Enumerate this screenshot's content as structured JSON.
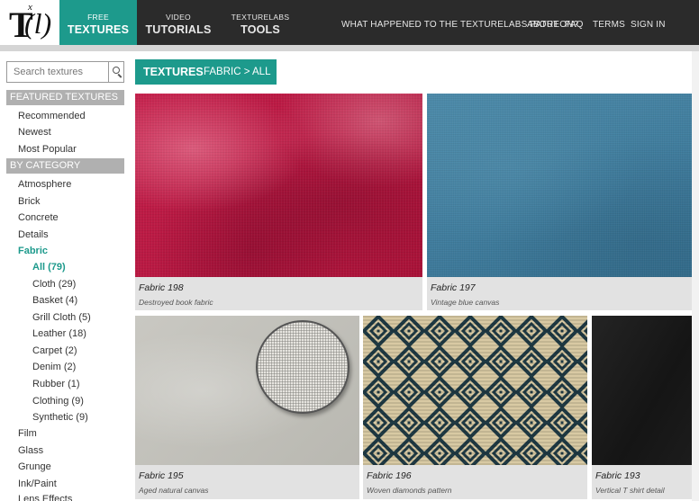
{
  "logo": {
    "letter": "T",
    "superscript": "x",
    "paren": "(l)"
  },
  "topnav": {
    "tabs": [
      {
        "small": "FREE",
        "big": "TEXTURES"
      },
      {
        "small": "VIDEO",
        "big": "TUTORIALS"
      },
      {
        "small": "TEXTURELABS",
        "big": "TOOLS"
      }
    ],
    "links": [
      "WHAT HAPPENED TO THE TEXTURELABS PATREON?",
      "ABOUT",
      "FAQ",
      "TERMS",
      "SIGN IN"
    ]
  },
  "search": {
    "placeholder": "Search textures"
  },
  "sidebar": {
    "featured_heading": "FEATURED TEXTURES",
    "featured": [
      "Recommended",
      "Newest",
      "Most Popular"
    ],
    "category_heading": "BY CATEGORY",
    "categories_top": [
      "Atmosphere",
      "Brick",
      "Concrete",
      "Details"
    ],
    "active_category": "Fabric",
    "subcategories": [
      "All (79)",
      "Cloth (29)",
      "Basket (4)",
      "Grill Cloth (5)",
      "Leather (18)",
      "Carpet (2)",
      "Denim (2)",
      "Rubber (1)",
      "Clothing (9)",
      "Synthetic (9)"
    ],
    "categories_bottom": [
      "Film",
      "Glass",
      "Grunge",
      "Ink/Paint",
      "Lens Effects"
    ]
  },
  "breadcrumb": {
    "section": "TEXTURES",
    "path": "FABRIC > ALL"
  },
  "cards": [
    {
      "title": "Fabric 198",
      "subtitle": "Destroyed book fabric"
    },
    {
      "title": "Fabric 197",
      "subtitle": "Vintage blue canvas"
    },
    {
      "title": "Fabric 195",
      "subtitle": "Aged natural canvas"
    },
    {
      "title": "Fabric 196",
      "subtitle": "Woven diamonds pattern"
    },
    {
      "title": "Fabric 193",
      "subtitle": "Vertical T shirt detail"
    }
  ],
  "colors": {
    "accent": "#1d9a8c",
    "nav_bg": "#2b2b2b",
    "sidebar_heading_bg": "#b0b0b0"
  }
}
